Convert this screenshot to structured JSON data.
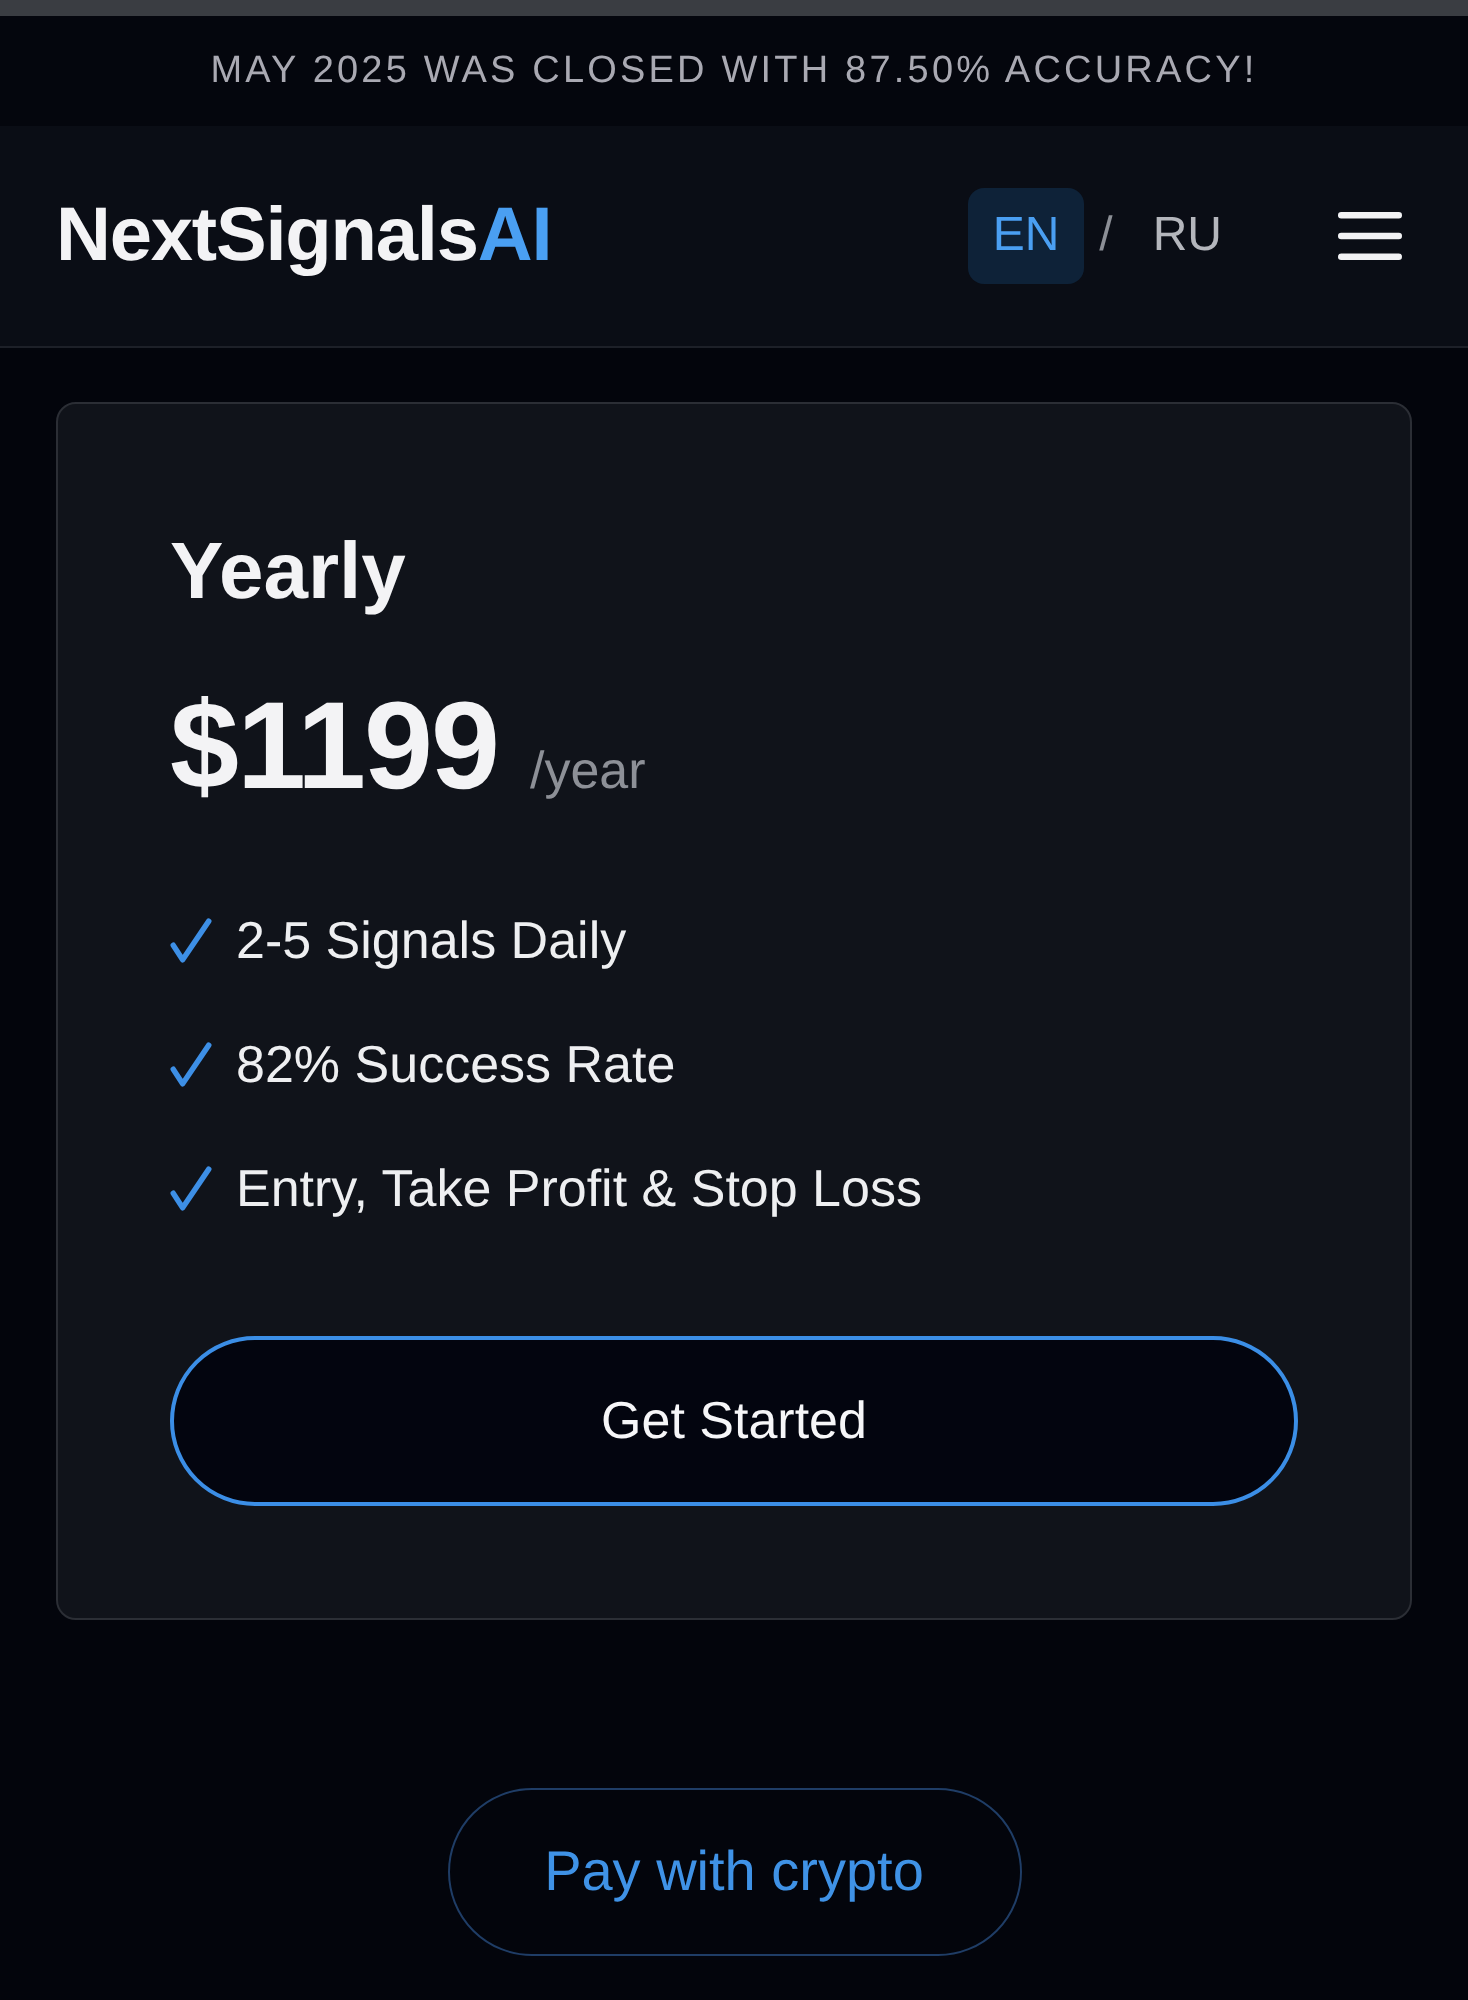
{
  "announcement": "MAY 2025 WAS CLOSED WITH 87.50% ACCURACY!",
  "header": {
    "logo": {
      "text": "NextSignals",
      "accent": "AI"
    },
    "languages": [
      {
        "label": "EN",
        "selected": true
      },
      {
        "label": "RU",
        "selected": false
      }
    ],
    "separator": "/"
  },
  "plan": {
    "name": "Yearly",
    "price": "$1199",
    "period": "/year",
    "features": [
      "2-5 Signals Daily",
      "82% Success Rate",
      "Entry, Take Profit & Stop Loss"
    ],
    "button": "Get Started"
  },
  "crypto_button": "Pay with crypto"
}
